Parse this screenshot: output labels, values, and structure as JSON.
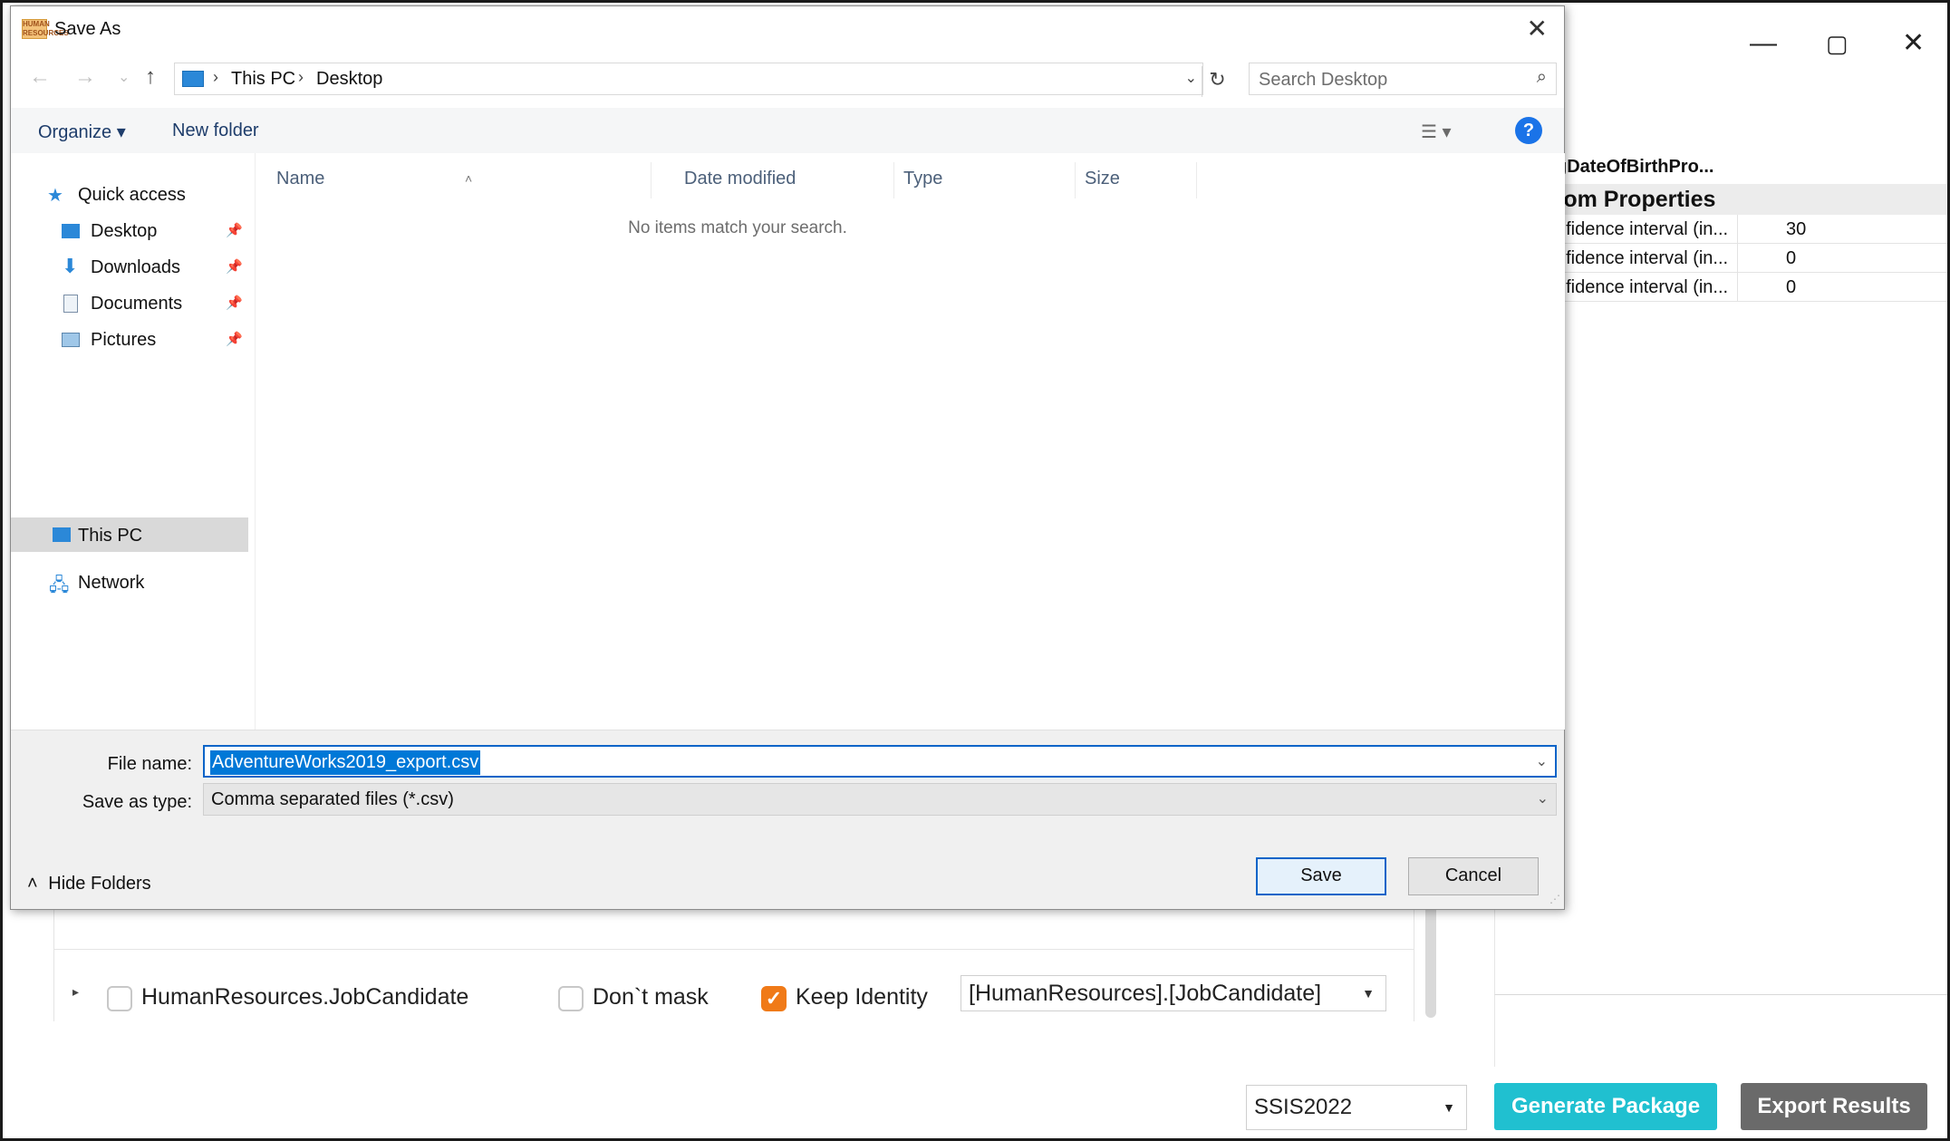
{
  "background": {
    "window_controls": {
      "minimize": "—",
      "maximize": "▢",
      "close": "✕"
    },
    "properties": {
      "name": "gDateOfBirthPro...",
      "category": "tom Properties",
      "rows": [
        {
          "name": "nfidence interval (in...",
          "value": "30"
        },
        {
          "name": "nfidence interval (in...",
          "value": "0"
        },
        {
          "name": "nfidence interval (in...",
          "value": "0"
        }
      ]
    },
    "tables": [
      {
        "name": "HumanResources.JobCandidate",
        "mask_label": "Don`t mask",
        "mask_checked": false,
        "identity_label": "Keep Identity",
        "identity_checked": true,
        "target": "[HumanResources].[JobCandidate]"
      }
    ],
    "ssis_version": "SSIS2022",
    "generate_label": "Generate Package",
    "export_label": "Export Results",
    "colors": {
      "teal": "#20c0d0",
      "grey": "#6a6a6a",
      "orange": "#f07a18"
    }
  },
  "dialog": {
    "title": "Save As",
    "app_icon_text": "HUMAN RESOURCES",
    "breadcrumb": [
      "This PC",
      "Desktop"
    ],
    "search_placeholder": "Search Desktop",
    "organize_label": "Organize ▾",
    "new_folder_label": "New folder",
    "help_label": "?",
    "nav": {
      "quick_access": "Quick access",
      "pinned": [
        "Desktop",
        "Downloads",
        "Documents",
        "Pictures"
      ],
      "this_pc": "This PC",
      "network": "Network"
    },
    "columns": [
      "Name",
      "Date modified",
      "Type",
      "Size"
    ],
    "empty_message": "No items match your search.",
    "file_name_label": "File name:",
    "file_name_value": "AdventureWorks2019_export.csv",
    "save_type_label": "Save as type:",
    "save_type_value": "Comma separated files (*.csv)",
    "hide_folders_label": "Hide Folders",
    "save_label": "Save",
    "cancel_label": "Cancel",
    "colors": {
      "accent": "#0078d7",
      "help": "#1a73e8"
    }
  }
}
